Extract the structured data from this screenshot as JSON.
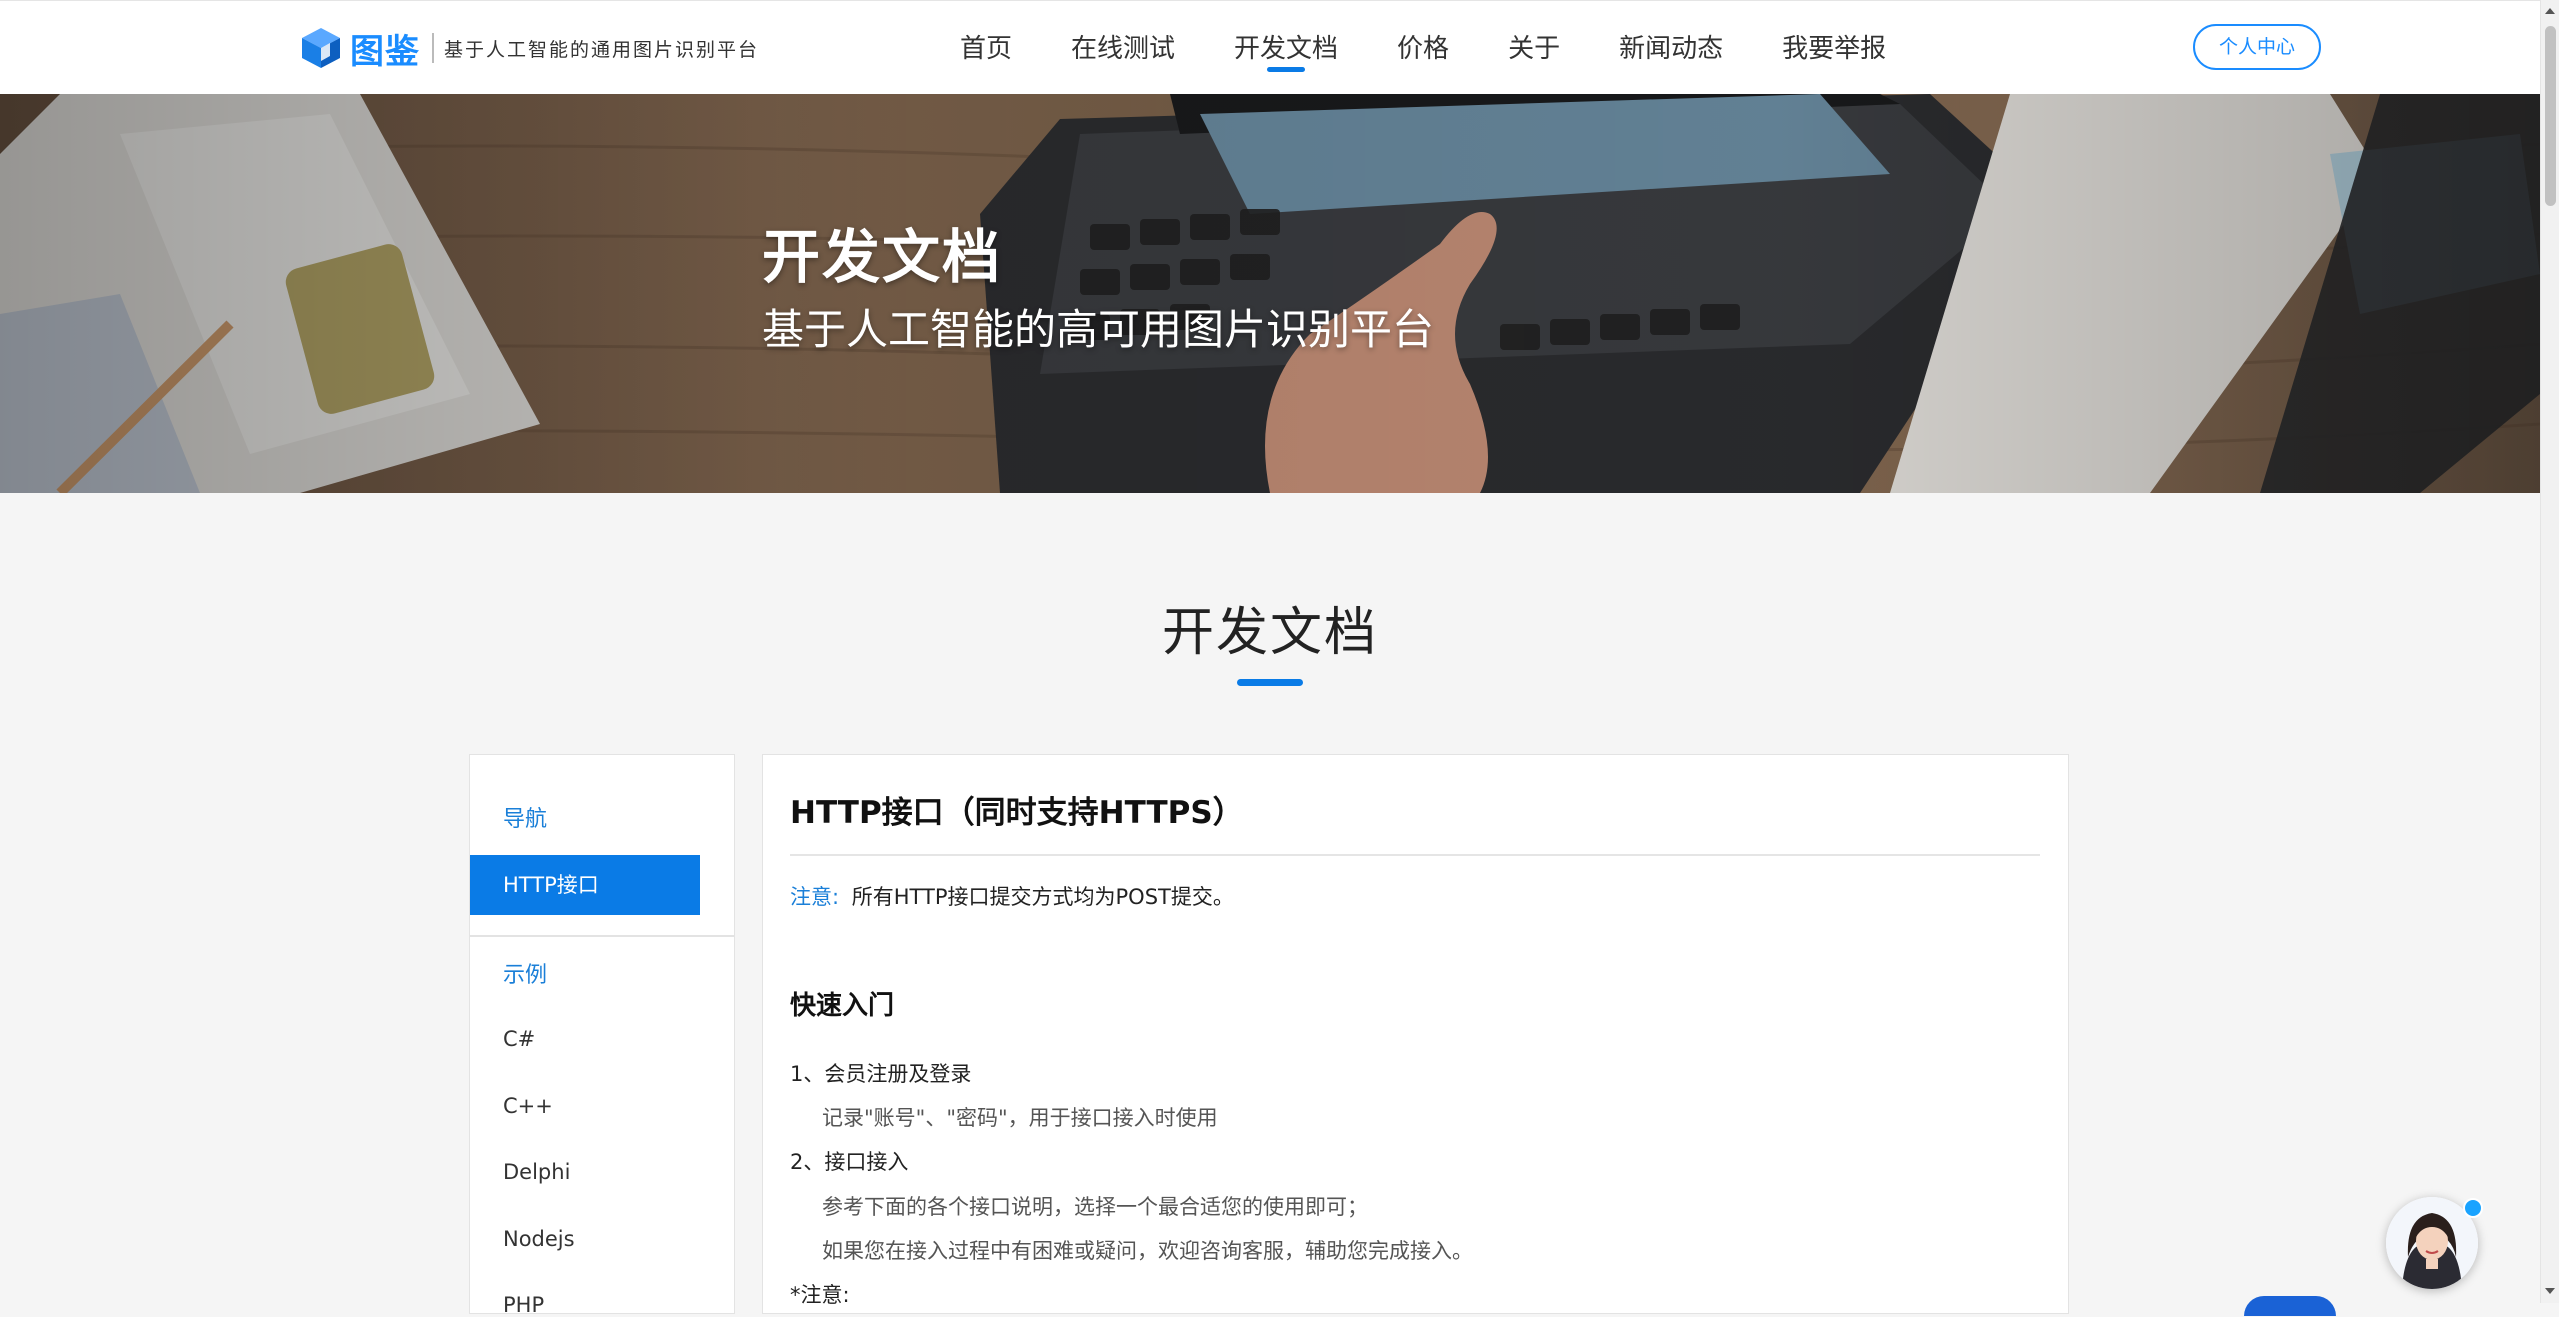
{
  "header": {
    "logo_text": "图鉴",
    "slogan": "基于人工智能的通用图片识别平台",
    "nav": [
      {
        "label": "首页",
        "active": false
      },
      {
        "label": "在线测试",
        "active": false
      },
      {
        "label": "开发文档",
        "active": true
      },
      {
        "label": "价格",
        "active": false
      },
      {
        "label": "关于",
        "active": false
      },
      {
        "label": "新闻动态",
        "active": false
      },
      {
        "label": "我要举报",
        "active": false
      }
    ],
    "user_center": "个人中心"
  },
  "banner": {
    "title": "开发文档",
    "subtitle": "基于人工智能的高可用图片识别平台"
  },
  "section": {
    "title": "开发文档"
  },
  "sidebar": {
    "group_nav": "导航",
    "http_item": "HTTP接口",
    "group_examples": "示例",
    "examples": [
      "C#",
      "C++",
      "Delphi",
      "Nodejs",
      "PHP"
    ]
  },
  "content": {
    "title": "HTTP接口（同时支持HTTPS）",
    "note_label": "注意:",
    "note_text": "所有HTTP接口提交方式均为POST提交。",
    "quickstart": "快速入门",
    "step1": "1、会员注册及登录",
    "step1_desc": "记录\"账号\"、\"密码\"，用于接口接入时使用",
    "step2": "2、接口接入",
    "step2_desc1": "参考下面的各个接口说明，选择一个最合适您的使用即可；",
    "step2_desc2": "如果您在接入过程中有困难或疑问，欢迎咨询客服，辅助您完成接入。",
    "note2": "*注意:"
  },
  "colors": {
    "accent": "#0a7be6",
    "link": "#1a7fd8",
    "background": "#f5f5f5"
  },
  "icons": {
    "logo": "cube-logo-icon",
    "support": "customer-service-avatar-icon"
  }
}
